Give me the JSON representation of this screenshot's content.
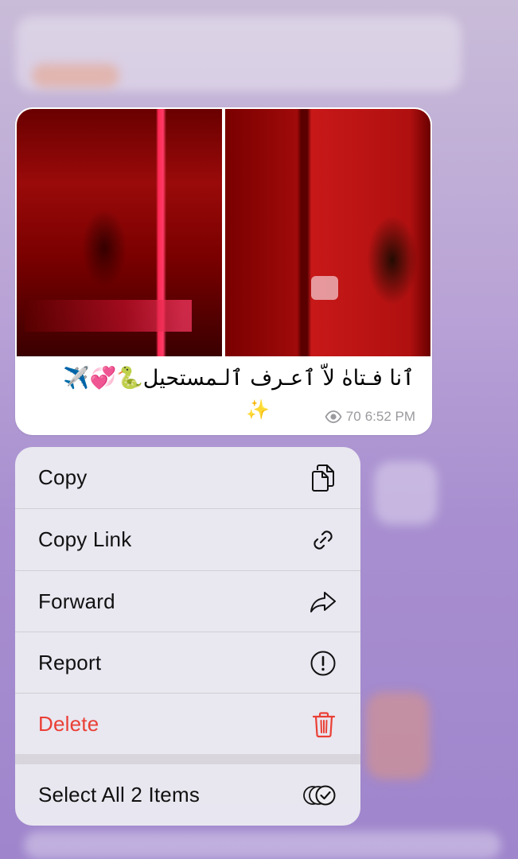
{
  "message": {
    "caption": "ٱنا فـتاهٰ لاّ ٱعـرف ٱلـمستحيل🐍💞✈️",
    "caption_extra": "✨",
    "views": "70",
    "time": "6:52 PM"
  },
  "context_menu": {
    "items": [
      {
        "label": "Copy",
        "icon": "copy-icon"
      },
      {
        "label": "Copy Link",
        "icon": "link-icon"
      },
      {
        "label": "Forward",
        "icon": "forward-arrow-icon"
      },
      {
        "label": "Report",
        "icon": "exclamation-circle-icon"
      },
      {
        "label": "Delete",
        "icon": "trash-icon",
        "color": "#ea3f35"
      },
      {
        "label": "Select All 2 Items",
        "icon": "select-all-icon"
      }
    ]
  }
}
